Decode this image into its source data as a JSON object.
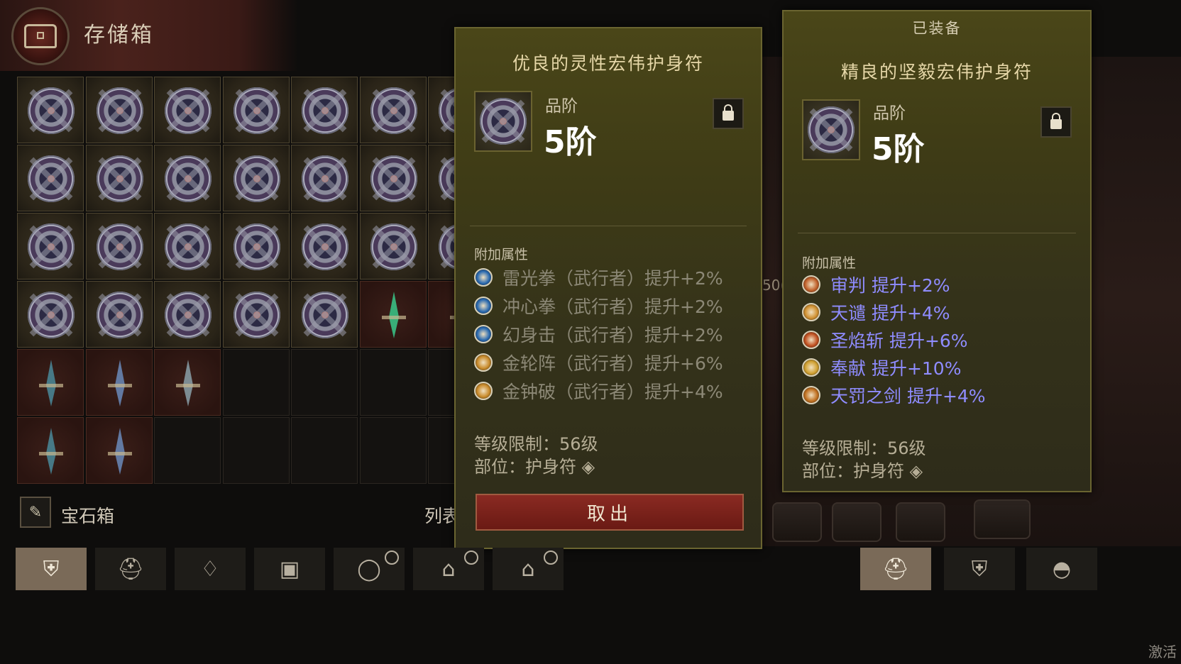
{
  "stash": {
    "title": "存储箱",
    "gem_box_label": "宝石箱",
    "list_label": "列表"
  },
  "compare_item": {
    "name": "优良的灵性宏伟护身符",
    "grade_label": "品阶",
    "grade_value": "5阶",
    "section_label": "附加属性",
    "attributes": [
      {
        "text": "雷光拳（武行者）提升+2%",
        "icon": "thunder-fist-icon",
        "color": "#2a6ab0"
      },
      {
        "text": "冲心拳（武行者）提升+2%",
        "icon": "heart-fist-icon",
        "color": "#2a6ab0"
      },
      {
        "text": "幻身击（武行者）提升+2%",
        "icon": "phantom-strike-icon",
        "color": "#2a6ab0"
      },
      {
        "text": "金轮阵（武行者）提升+6%",
        "icon": "golden-wheel-icon",
        "color": "#c88a2a"
      },
      {
        "text": "金钟破（武行者）提升+4%",
        "icon": "golden-bell-icon",
        "color": "#c88a2a"
      }
    ],
    "level_req": "等级限制：56级",
    "slot": "部位：护身符",
    "take_button": "取出"
  },
  "equipped_item": {
    "header": "已装备",
    "name": "精良的坚毅宏伟护身符",
    "grade_label": "品阶",
    "grade_value": "5阶",
    "section_label": "附加属性",
    "attributes": [
      {
        "text": "审判  提升+2%",
        "icon": "judgment-icon",
        "color": "#c0602a"
      },
      {
        "text": "天谴  提升+4%",
        "icon": "wrath-icon",
        "color": "#d09030"
      },
      {
        "text": "圣焰斩  提升+6%",
        "icon": "holy-flame-icon",
        "color": "#c05020"
      },
      {
        "text": "奉献  提升+10%",
        "icon": "devotion-icon",
        "color": "#d0a030"
      },
      {
        "text": "天罚之剑  提升+4%",
        "icon": "heaven-sword-icon",
        "color": "#c07020"
      }
    ],
    "level_req": "等级限制：56级",
    "slot": "部位：护身符"
  },
  "scene": {
    "partial_text": "50("
  },
  "tabs_left": [
    {
      "icon": "helmet-crest-icon",
      "active": true,
      "clock": false
    },
    {
      "icon": "helmet-icon",
      "active": false,
      "clock": false
    },
    {
      "icon": "necklace-icon",
      "active": false,
      "clock": false
    },
    {
      "icon": "chest-icon",
      "active": false,
      "clock": false
    },
    {
      "icon": "ring-icon",
      "active": false,
      "clock": true
    },
    {
      "icon": "treasure-icon",
      "active": false,
      "clock": true
    },
    {
      "icon": "treasure-icon",
      "active": false,
      "clock": true
    }
  ],
  "tabs_right": [
    {
      "icon": "helmet-icon",
      "active": true
    },
    {
      "icon": "helmet-crest-icon",
      "active": false
    },
    {
      "icon": "bag-icon",
      "active": false
    }
  ],
  "corner_text": "激活"
}
